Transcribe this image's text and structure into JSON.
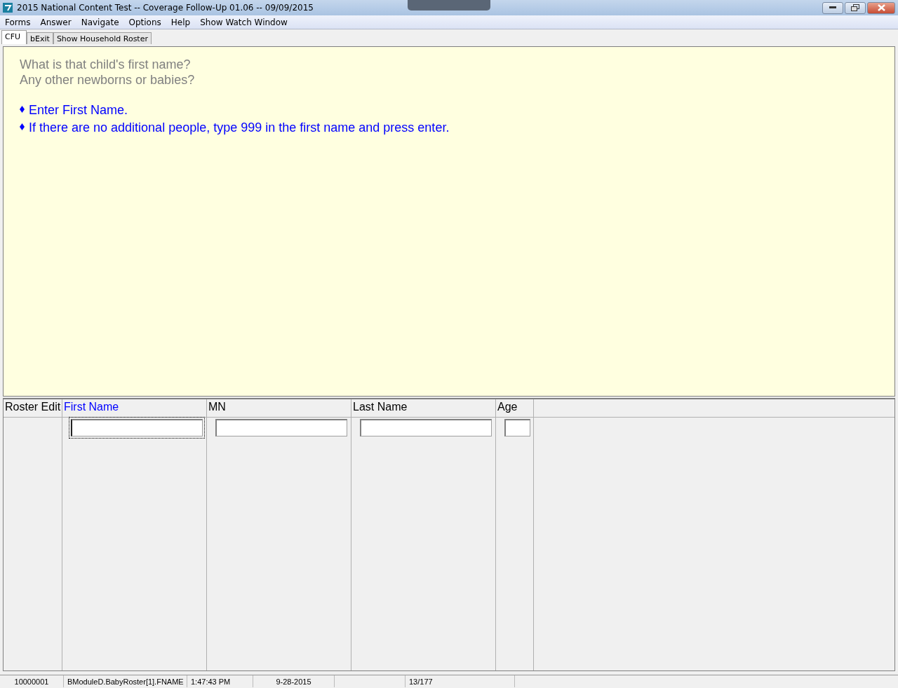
{
  "window": {
    "title": "2015 National Content Test -- Coverage Follow-Up 01.06 -- 09/09/2015"
  },
  "menu": [
    "Forms",
    "Answer",
    "Navigate",
    "Options",
    "Help",
    "Show Watch Window"
  ],
  "tabs": [
    {
      "label": "CFU",
      "selected": true
    },
    {
      "label": "bExit",
      "selected": false
    },
    {
      "label": "Show Household Roster",
      "selected": false
    }
  ],
  "question": [
    "What is that child's first name?",
    "Any other newborns or babies?"
  ],
  "instructions": [
    "Enter First Name.",
    "If there are no additional people, type 999 in the first name and press enter."
  ],
  "roster": {
    "label": "Roster Edit",
    "columns": [
      {
        "name": "First Name",
        "selected": true
      },
      {
        "name": "MN",
        "selected": false
      },
      {
        "name": "Last Name",
        "selected": false
      },
      {
        "name": "Age",
        "selected": false
      }
    ]
  },
  "status_bar": [
    "10000001",
    "BModuleD.BabyRoster[1].FNAME",
    "1:47:43 PM",
    "9-28-2015",
    "13/177"
  ]
}
